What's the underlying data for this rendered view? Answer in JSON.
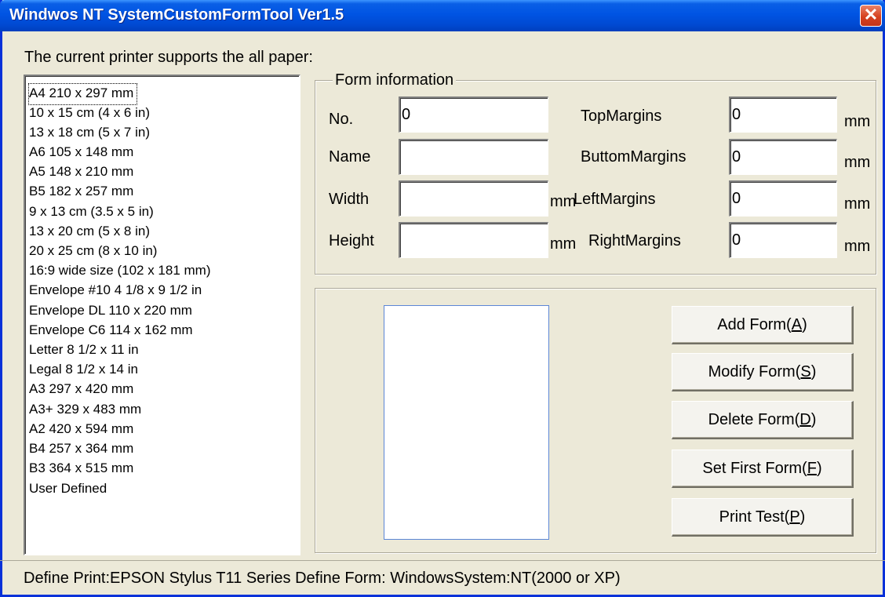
{
  "window": {
    "title": "Windwos NT SystemCustomFormTool Ver1.5",
    "close_glyph": "✕"
  },
  "supports_label": "The current printer supports the all paper:",
  "paper_list": [
    "A4 210 x 297 mm",
    "10 x 15 cm (4 x 6 in)",
    "13 x 18 cm (5 x 7 in)",
    "A6 105 x 148 mm",
    "A5 148 x 210 mm",
    "B5 182 x 257 mm",
    "9 x 13 cm (3.5 x 5 in)",
    "13 x 20 cm (5 x 8 in)",
    "20 x 25 cm (8 x 10 in)",
    "16:9 wide size (102 x 181 mm)",
    "Envelope #10 4 1/8 x 9 1/2 in",
    "Envelope DL  110 x 220 mm",
    "Envelope C6  114 x 162 mm",
    "Letter 8 1/2 x 11 in",
    "Legal 8 1/2 x 14 in",
    "A3 297 x 420 mm",
    "A3+ 329 x 483 mm",
    "A2 420 x 594 mm",
    "B4 257 x 364 mm",
    "B3 364 x 515 mm",
    "User Defined"
  ],
  "form_info": {
    "title": "Form information",
    "no_label": "No.",
    "no_value": "0",
    "name_label": "Name",
    "name_value": "",
    "width_label": "Width",
    "width_value": "",
    "width_unit": "mm",
    "height_label": "Height",
    "height_value": "",
    "height_unit": "mm",
    "top_label": "TopMargins",
    "top_value": "0",
    "top_unit": "mm",
    "bottom_label": "ButtomMargins",
    "bottom_value": "0",
    "bottom_unit": "mm",
    "left_label": "LeftMargins",
    "left_value": "0",
    "left_unit": "mm",
    "right_label": "RightMargins",
    "right_value": "0",
    "right_unit": "mm"
  },
  "buttons": {
    "add": {
      "text": "Add Form(",
      "key": "A",
      "end": ")"
    },
    "modify": {
      "text": "Modify Form(",
      "key": "S",
      "end": ")"
    },
    "delete": {
      "text": "Delete Form(",
      "key": "D",
      "end": ")"
    },
    "setfirst": {
      "text": "Set First Form(",
      "key": "F",
      "end": ")"
    },
    "print": {
      "text": "Print Test(",
      "key": "P",
      "end": ")"
    }
  },
  "status": "Define Print:EPSON Stylus T11 Series Define Form: WindowsSystem:NT(2000 or XP)"
}
